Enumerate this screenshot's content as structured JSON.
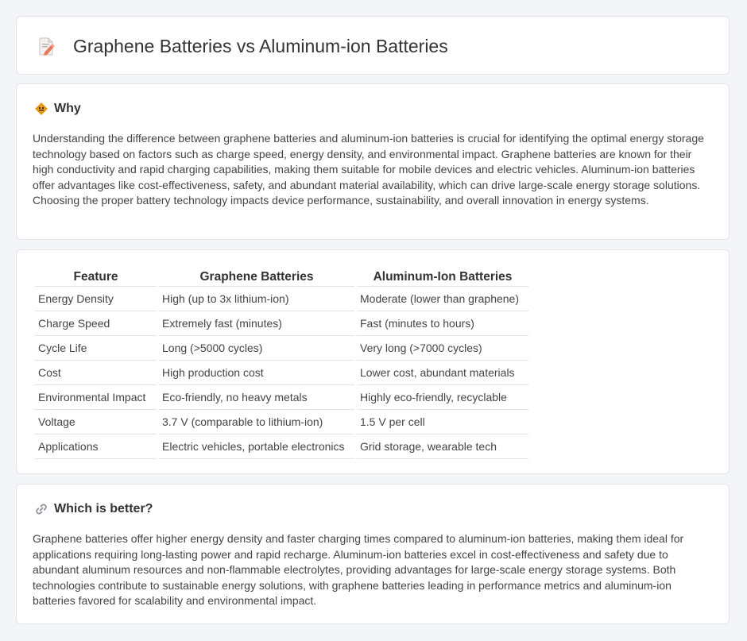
{
  "header": {
    "title": "Graphene Batteries vs Aluminum-ion Batteries",
    "icon": "document-pencil-icon"
  },
  "why": {
    "heading": "Why",
    "icon": "road-sign-icon",
    "text": "Understanding the difference between graphene batteries and aluminum-ion batteries is crucial for identifying the optimal energy storage technology based on factors such as charge speed, energy density, and environmental impact. Graphene batteries are known for their high conductivity and rapid charging capabilities, making them suitable for mobile devices and electric vehicles. Aluminum-ion batteries offer advantages like cost-effectiveness, safety, and abundant material availability, which can drive large-scale energy storage solutions. Choosing the proper battery technology impacts device performance, sustainability, and overall innovation in energy systems."
  },
  "comparison": {
    "headers": [
      "Feature",
      "Graphene Batteries",
      "Aluminum-Ion Batteries"
    ],
    "rows": [
      [
        "Energy Density",
        "High (up to 3x lithium-ion)",
        "Moderate (lower than graphene)"
      ],
      [
        "Charge Speed",
        "Extremely fast (minutes)",
        "Fast (minutes to hours)"
      ],
      [
        "Cycle Life",
        "Long (>5000 cycles)",
        "Very long (>7000 cycles)"
      ],
      [
        "Cost",
        "High production cost",
        "Lower cost, abundant materials"
      ],
      [
        "Environmental Impact",
        "Eco-friendly, no heavy metals",
        "Highly eco-friendly, recyclable"
      ],
      [
        "Voltage",
        "3.7 V (comparable to lithium-ion)",
        "1.5 V per cell"
      ],
      [
        "Applications",
        "Electric vehicles, portable electronics",
        "Grid storage, wearable tech"
      ]
    ]
  },
  "better": {
    "heading": "Which is better?",
    "icon": "link-icon",
    "text": "Graphene batteries offer higher energy density and faster charging times compared to aluminum-ion batteries, making them ideal for applications requiring long-lasting power and rapid recharge. Aluminum-ion batteries excel in cost-effectiveness and safety due to abundant aluminum resources and non-flammable electrolytes, providing advantages for large-scale energy storage systems. Both technologies contribute to sustainable energy solutions, with graphene batteries leading in performance metrics and aluminum-ion batteries favored for scalability and environmental impact."
  }
}
